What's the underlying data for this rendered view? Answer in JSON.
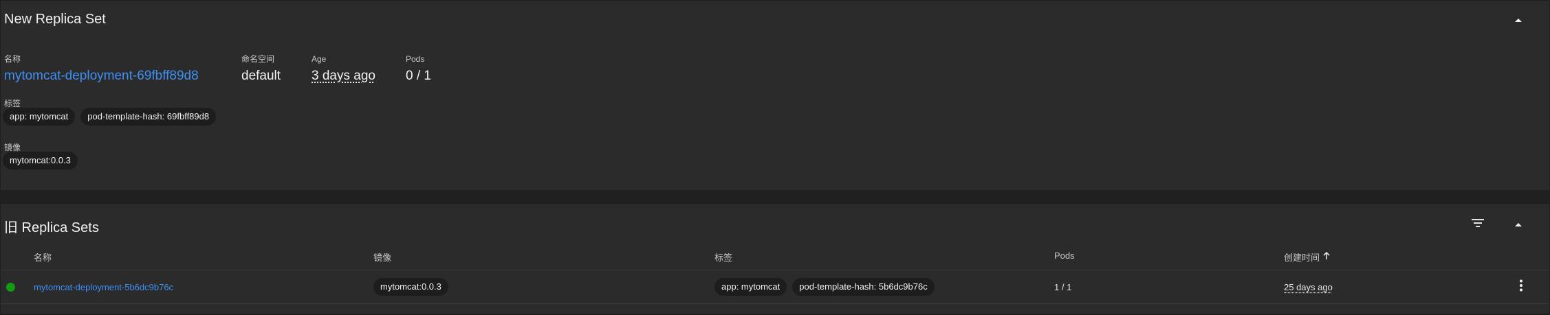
{
  "new_replica_set": {
    "title": "New Replica Set",
    "meta": {
      "name_label": "名称",
      "name_value": "mytomcat-deployment-69fbff89d8",
      "namespace_label": "命名空间",
      "namespace_value": "default",
      "age_label": "Age",
      "age_value": "3 days ago",
      "pods_label": "Pods",
      "pods_value": "0 / 1"
    },
    "labels_label": "标签",
    "labels": [
      "app: mytomcat",
      "pod-template-hash: 69fbff89d8"
    ],
    "images_label": "镜像",
    "images": [
      "mytomcat:0.0.3"
    ]
  },
  "old_replica_sets": {
    "title": "旧 Replica Sets",
    "columns": {
      "name": "名称",
      "image": "镜像",
      "labels": "标签",
      "pods": "Pods",
      "created": "创建时间"
    },
    "sort": {
      "column": "created",
      "direction": "ascending",
      "icon": "arrow-up-icon"
    },
    "rows": [
      {
        "status": "running",
        "status_color": "#139a13",
        "name": "mytomcat-deployment-5b6dc9b76c",
        "image": "mytomcat:0.0.3",
        "labels": [
          "app: mytomcat",
          "pod-template-hash: 5b6dc9b76c"
        ],
        "pods": "1 / 1",
        "created": "25 days ago"
      }
    ]
  },
  "icons": {
    "collapse": "chevron-up-icon",
    "filter": "filter-icon",
    "more": "more-vert-icon"
  },
  "colors": {
    "background": "#202020",
    "card": "#2b2b2b",
    "link": "#3f8ff4",
    "chip": "#1d1d1d",
    "status_running": "#139a13"
  }
}
